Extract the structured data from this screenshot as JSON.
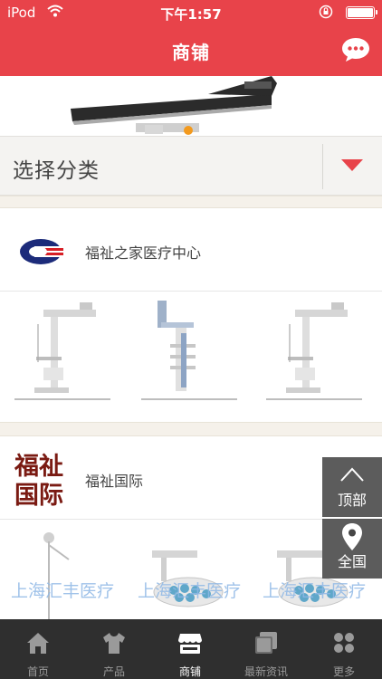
{
  "status_bar": {
    "carrier": "iPod",
    "time": "下午1:57"
  },
  "nav": {
    "title": "商铺"
  },
  "category": {
    "label": "选择分类"
  },
  "shops": [
    {
      "name": "福祉之家医疗中心"
    },
    {
      "name": "福祉国际",
      "logo_text": "福祉国际"
    }
  ],
  "watermark_text": "上海汇丰医疗",
  "float_buttons": {
    "top": "顶部",
    "all": "全国"
  },
  "tabs": [
    {
      "label": "首页",
      "icon": "home-icon"
    },
    {
      "label": "产品",
      "icon": "shirt-icon"
    },
    {
      "label": "商铺",
      "icon": "store-icon"
    },
    {
      "label": "最新资讯",
      "icon": "news-icon"
    },
    {
      "label": "更多",
      "icon": "more-icon"
    }
  ],
  "colors": {
    "brand": "#e8434a",
    "tab_bg": "#2f2f2f",
    "float_bg": "#464646"
  }
}
